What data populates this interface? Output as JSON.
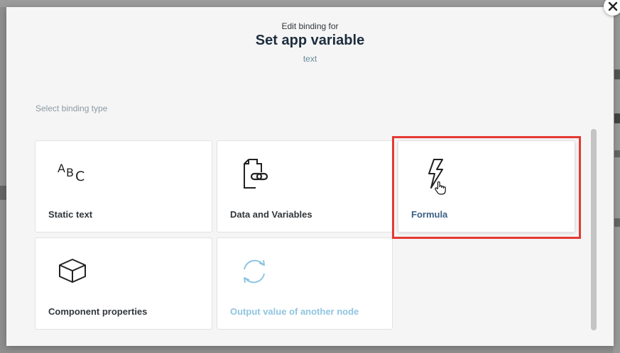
{
  "dialog": {
    "subtitle": "Edit binding for",
    "title": "Set app variable",
    "property": "text",
    "close_icon": "close-icon"
  },
  "section_label": "Select binding type",
  "binding_types": [
    {
      "label": "Static text",
      "icon": "abc-text-icon"
    },
    {
      "label": "Data and Variables",
      "icon": "document-link-icon"
    },
    {
      "label": "Formula",
      "icon": "lightning-bolt-icon",
      "selected": true
    },
    {
      "label": "Component properties",
      "icon": "cube-icon"
    },
    {
      "label": "Output value of another node",
      "icon": "refresh-cycle-icon",
      "disabled": true
    }
  ],
  "colors": {
    "highlight": "#e53935",
    "disabled_text": "#8fc5e0",
    "selected_text": "#3c6185"
  }
}
